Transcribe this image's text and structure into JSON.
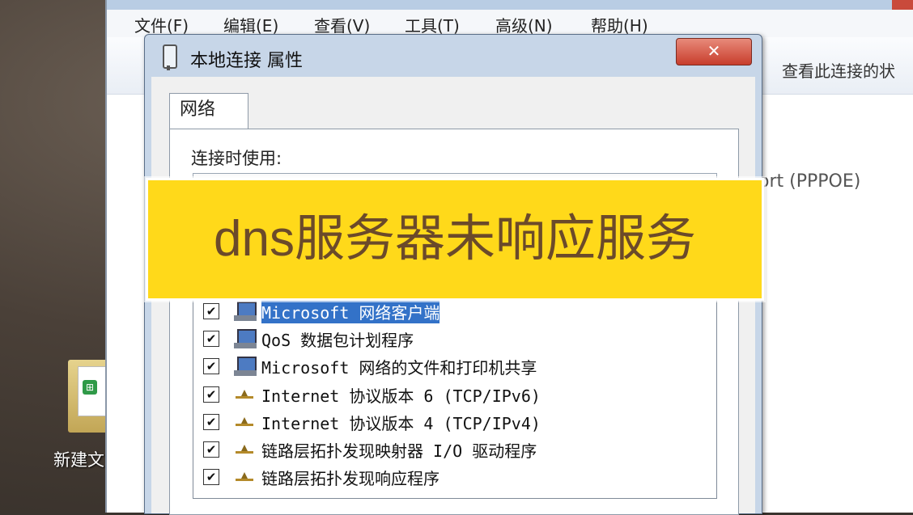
{
  "explorer": {
    "menu": [
      "文件(F)",
      "编辑(E)",
      "查看(V)",
      "工具(T)",
      "高级(N)",
      "帮助(H)"
    ],
    "toolbar_text": "查看此连接的状",
    "behind_text": "ort (PPPOE)"
  },
  "desktop": {
    "icon_label": "新建文"
  },
  "dialog": {
    "title": "本地连接 属性",
    "close_glyph": "✕",
    "tab_label": "网络",
    "connect_label": "连接时使用:",
    "components": [
      {
        "label": "Microsoft 网络客户端",
        "checked": true,
        "icon": "pc",
        "selected": true
      },
      {
        "label": "QoS 数据包计划程序",
        "checked": true,
        "icon": "pc",
        "selected": false
      },
      {
        "label": "Microsoft 网络的文件和打印机共享",
        "checked": true,
        "icon": "pc",
        "selected": false
      },
      {
        "label": "Internet 协议版本 6 (TCP/IPv6)",
        "checked": true,
        "icon": "net",
        "selected": false
      },
      {
        "label": "Internet 协议版本 4 (TCP/IPv4)",
        "checked": true,
        "icon": "net",
        "selected": false
      },
      {
        "label": "链路层拓扑发现映射器 I/O 驱动程序",
        "checked": true,
        "icon": "net",
        "selected": false
      },
      {
        "label": "链路层拓扑发现响应程序",
        "checked": true,
        "icon": "net",
        "selected": false
      }
    ],
    "check_glyph": "✔"
  },
  "overlay": {
    "caption": "dns服务器未响应服务"
  }
}
